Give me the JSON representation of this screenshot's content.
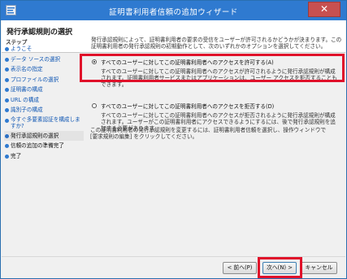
{
  "window": {
    "title": "証明書利用者信頼の追加ウィザード",
    "close_glyph": "✕",
    "icon": "wizard-app-icon"
  },
  "header": {
    "title": "発行承認規則の選択"
  },
  "steps": {
    "heading": "ステップ",
    "items": [
      {
        "label": "ようこそ",
        "state": "done"
      },
      {
        "label": "データ ソースの選択",
        "state": "done"
      },
      {
        "label": "表示名の指定",
        "state": "done"
      },
      {
        "label": "プロファイルの選択",
        "state": "done"
      },
      {
        "label": "証明書の構成",
        "state": "done"
      },
      {
        "label": "URL の構成",
        "state": "done"
      },
      {
        "label": "識別子の構成",
        "state": "done"
      },
      {
        "label": "今すぐ多要素認証を構成しますか?",
        "state": "done"
      },
      {
        "label": "発行承認規則の選択",
        "state": "current"
      },
      {
        "label": "信頼の追加の準備完了",
        "state": "future"
      },
      {
        "label": "完了",
        "state": "future"
      }
    ]
  },
  "content": {
    "intro": "発行承認規則によって、証明書利用者の要求の受信をユーザーが許可されるかどうかが決まります。この証明書利用者の発行承認規則の初期動作として、次のいずれかのオプションを選択してください。",
    "options": [
      {
        "label": "すべてのユーザーに対してこの証明書利用者へのアクセスを許可する(A)",
        "desc": "すべてのユーザーに対してこの証明書利用者へのアクセスが許可されるように発行承認規則が構成されます。証明書利用者サービスまたはアプリケーションは、ユーザー アクセスを拒否することもできます。",
        "selected": true
      },
      {
        "label": "すべてのユーザーに対してこの証明書利用者へのアクセスを拒否する(D)",
        "desc": "すべてのユーザーに対してこの証明書利用者へのアクセスが拒否されるように発行承認規則が構成されます。ユーザーがこの証明書利用者にアクセスできるようにするには、後で発行承認規則を追加する必要があります。",
        "selected": false
      }
    ],
    "note": "この証明書利用者の発行承認規則を変更するには、証明書利用者信頼を選択し、操作ウィンドウで [要求規則の編集] をクリックしてください。"
  },
  "buttons": {
    "back": "< 前へ(P)",
    "next": "次へ(N) >",
    "cancel": "キャンセル"
  },
  "colors": {
    "titlebar": "#2f7ad0",
    "highlight": "#e0102a",
    "close": "#c75050"
  }
}
